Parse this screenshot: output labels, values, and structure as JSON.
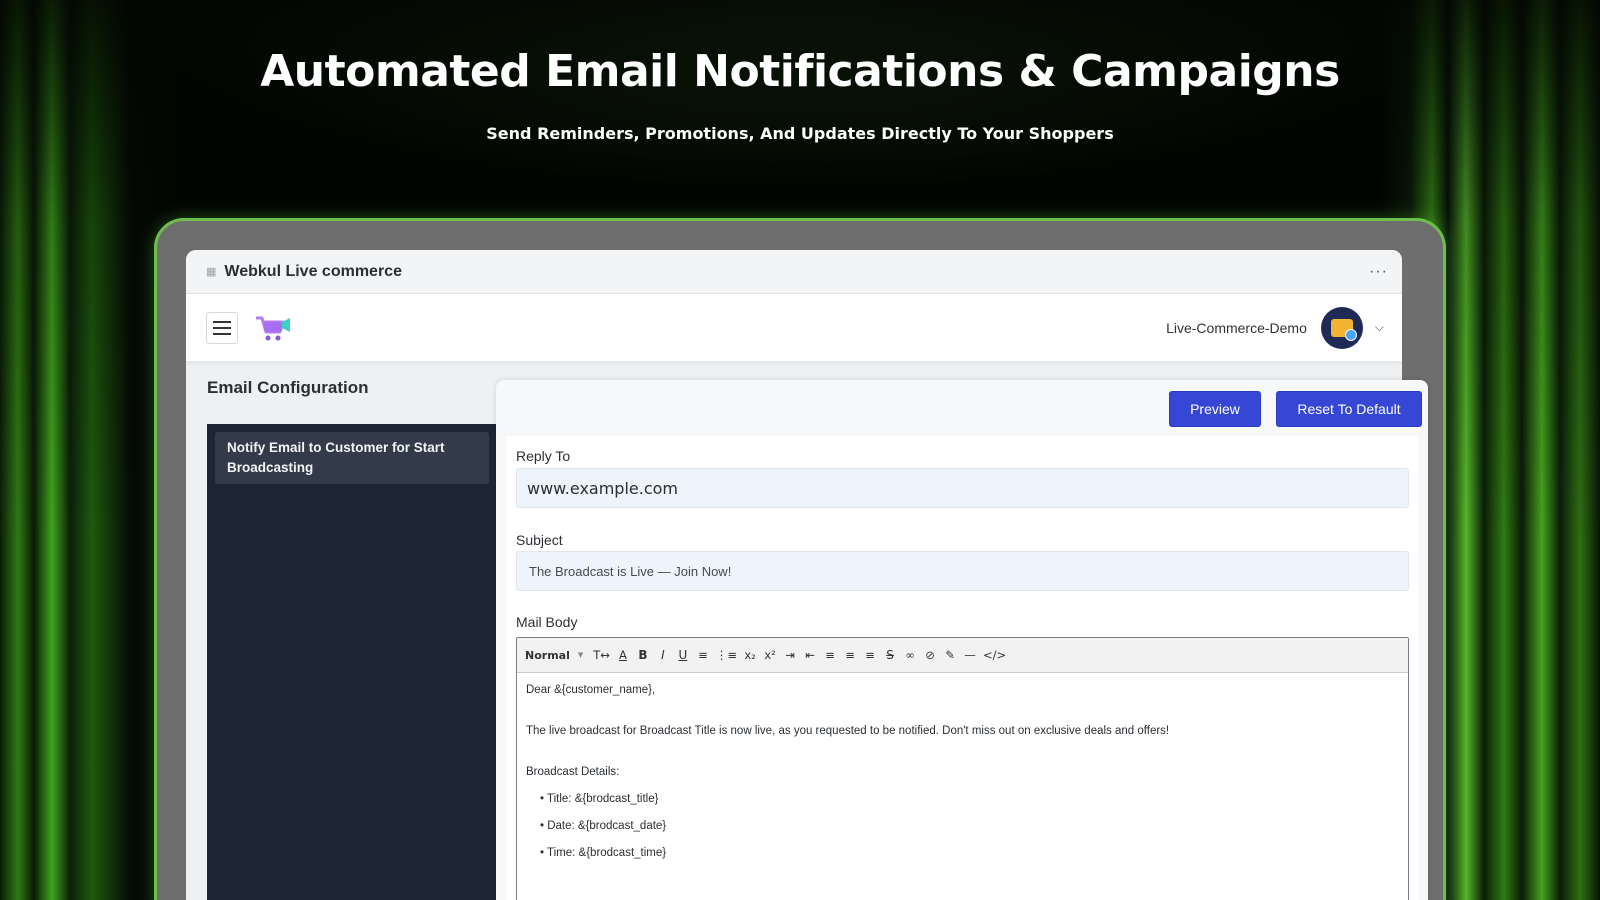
{
  "hero": {
    "title": "Automated Email Notifications & Campaigns",
    "subtitle": "Send Reminders, Promotions, And Updates Directly To Your Shoppers"
  },
  "window": {
    "title": "Webkul Live commerce",
    "more": "···"
  },
  "topnav": {
    "store_name": "Live-Commerce-Demo",
    "chevron": "⌵"
  },
  "page": {
    "title": "Email Configuration"
  },
  "sidebar": {
    "items": [
      {
        "label": "Notify Email to Customer for Start Broadcasting"
      }
    ]
  },
  "actions": {
    "preview": "Preview",
    "reset": "Reset To Default"
  },
  "form": {
    "reply_to": {
      "label": "Reply To",
      "value": "www.example.com"
    },
    "subject": {
      "label": "Subject",
      "value": "The Broadcast is Live — Join Now!"
    },
    "mail_body": {
      "label": "Mail Body",
      "format": "Normal",
      "lines": {
        "greeting": "Dear &{customer_name},",
        "intro": "The live broadcast for Broadcast Title is now live, as you requested to be notified. Don't miss out on exclusive deals and offers!",
        "details_heading": "Broadcast Details:",
        "title": "• Title: &{brodcast_title}",
        "date": "• Date: &{brodcast_date}",
        "time": "• Time: &{brodcast_time}"
      }
    }
  },
  "colors": {
    "primary_button": "#3647d6",
    "sidebar_bg": "#1e2534",
    "input_bg": "#eef3fc",
    "accent_glow": "#6cbf4a"
  }
}
